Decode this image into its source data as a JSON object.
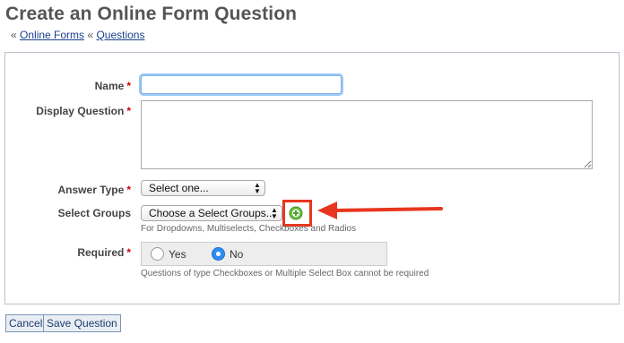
{
  "page": {
    "title": "Create an Online Form Question"
  },
  "breadcrumb": {
    "prefix": "«",
    "link1": "Online Forms",
    "sep": "«",
    "link2": "Questions"
  },
  "form": {
    "required_marker": "*",
    "name": {
      "label": "Name",
      "value": "",
      "placeholder": ""
    },
    "display_question": {
      "label": "Display Question",
      "value": ""
    },
    "answer_type": {
      "label": "Answer Type",
      "selected": "Select one..."
    },
    "select_groups": {
      "label": "Select Groups",
      "selected": "Choose a Select Groups...",
      "add_icon": "add-circle-icon",
      "hint": "For Dropdowns, Multiselects, Checkboxes and Radios"
    },
    "required": {
      "label": "Required",
      "options": [
        {
          "label": "Yes",
          "checked": false
        },
        {
          "label": "No",
          "checked": true
        }
      ],
      "hint": "Questions of type Checkboxes or Multiple Select Box cannot be required"
    }
  },
  "buttons": {
    "cancel": "Cancel",
    "save": "Save Question"
  },
  "annotation": {
    "color": "#e8361e"
  }
}
